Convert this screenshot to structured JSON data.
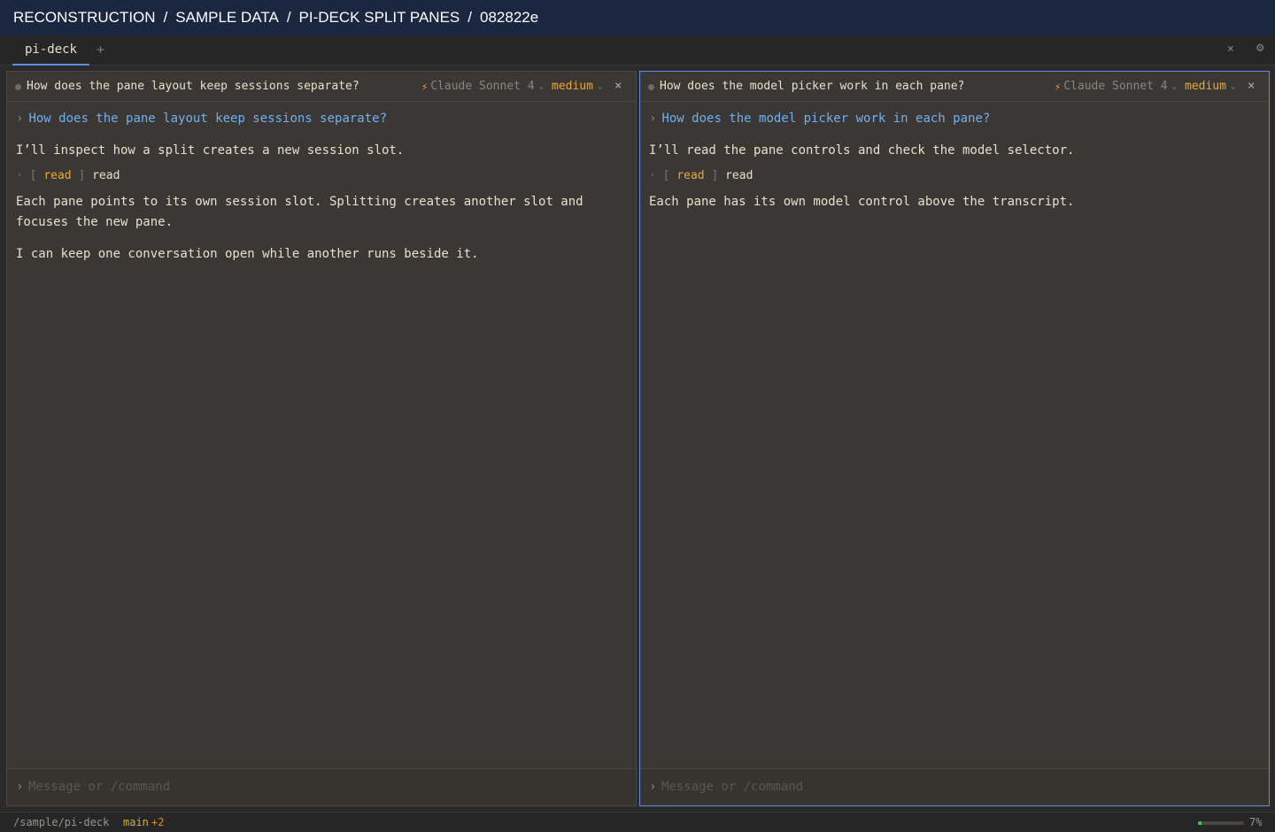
{
  "breadcrumb": [
    "RECONSTRUCTION",
    "SAMPLE DATA",
    "PI-DECK SPLIT PANES",
    "082822e"
  ],
  "breadcrumb_separator": "/",
  "tabs": [
    {
      "label": "pi-deck",
      "active": true
    }
  ],
  "tab_add_label": "+",
  "tab_close_label": "×",
  "settings_icon": "⚙",
  "panes": [
    {
      "title": "How does the pane layout keep sessions separate?",
      "model": "Claude Sonnet 4",
      "effort": "medium",
      "close_label": "×",
      "active": false,
      "user_message": "How does the pane layout keep sessions separate?",
      "intro": "I’ll inspect how a split creates a new session slot.",
      "tool": {
        "open": "[",
        "name": "read",
        "close": "]",
        "detail": "read"
      },
      "paragraphs": [
        "Each pane points to its own session slot. Splitting creates another slot and focuses the new pane.",
        "I can keep one conversation open while another runs beside it."
      ],
      "composer_placeholder": "Message or /command"
    },
    {
      "title": "How does the model picker work in each pane?",
      "model": "Claude Sonnet 4",
      "effort": "medium",
      "close_label": "×",
      "active": true,
      "user_message": "How does the model picker work in each pane?",
      "intro": "I’ll read the pane controls and check the model selector.",
      "tool": {
        "open": "[",
        "name": "read",
        "close": "]",
        "detail": "read"
      },
      "paragraphs": [
        "Each pane has its own model control above the transcript."
      ],
      "composer_placeholder": "Message or /command"
    }
  ],
  "statusbar": {
    "path": "/sample/pi-deck",
    "branch": "main",
    "changes": "+2",
    "context_percent": 7,
    "context_label": "7%"
  },
  "colors": {
    "accent": "#5b8fe0",
    "model_bolt": "#e8a838",
    "user_text": "#6fb0f0",
    "progress_fill": "#4ec24e"
  }
}
